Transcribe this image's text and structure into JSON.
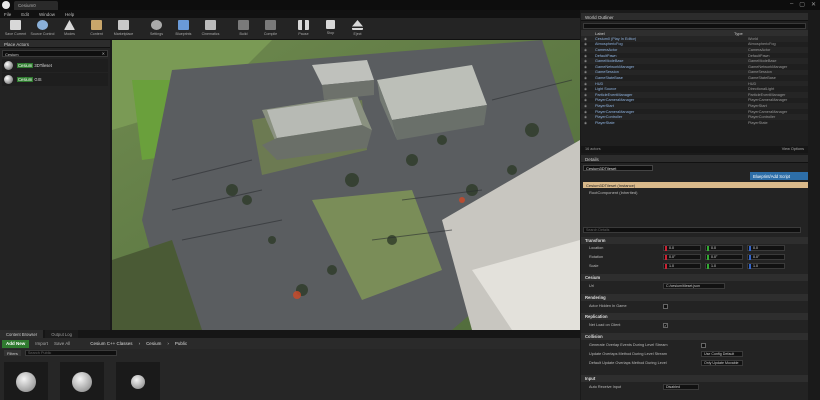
{
  "window": {
    "tab_title": "Cesium0",
    "controls": [
      "–",
      "▢",
      "✕"
    ]
  },
  "menu": [
    "File",
    "Edit",
    "Window",
    "Help"
  ],
  "toolbar": {
    "buttons": [
      {
        "label": "Save Current",
        "icon": "save-icon",
        "color": "#d8d8d8"
      },
      {
        "label": "Source Control",
        "icon": "source-control-icon",
        "color": "#8ab0d8"
      },
      {
        "label": "Modes",
        "icon": "modes-icon",
        "color": "#d8d8d8"
      },
      {
        "label": "Content",
        "icon": "content-icon",
        "color": "#c9a66b"
      },
      {
        "label": "Marketplace",
        "icon": "marketplace-icon",
        "color": "#c8c8c8"
      },
      {
        "label": "Settings",
        "icon": "settings-icon",
        "color": "#aaaaaa"
      },
      {
        "label": "Blueprints",
        "icon": "blueprints-icon",
        "color": "#6a9ad8"
      },
      {
        "label": "Cinematics",
        "icon": "cinematics-icon",
        "color": "#bbbbbb"
      },
      {
        "label": "Build",
        "icon": "build-icon",
        "color": "#7a7a7a"
      },
      {
        "label": "Compile",
        "icon": "compile-icon",
        "color": "#7a7a7a"
      },
      {
        "label": "Pause",
        "icon": "pause-icon",
        "color": "#d8d8d8"
      },
      {
        "label": "Stop",
        "icon": "stop-icon",
        "color": "#d8d8d8"
      },
      {
        "label": "Eject",
        "icon": "eject-icon",
        "color": "#d8d8d8"
      }
    ]
  },
  "place_actors": {
    "tab": "Place Actors",
    "search_value": "Cesium",
    "items": [
      {
        "highlight": "Cesium",
        "rest": " 3DTileset"
      },
      {
        "highlight": "Cesium",
        "rest": " GIS"
      }
    ]
  },
  "outliner": {
    "title": "World Outliner",
    "col_label": "Label",
    "col_type": "Type",
    "rows": [
      {
        "label": "Cesium0 (Play In Editor)",
        "type": "World"
      },
      {
        "label": "AtmosphericFog",
        "type": "AtmosphericFog"
      },
      {
        "label": "CameraActor",
        "type": "CameraActor"
      },
      {
        "label": "DefaultPawn",
        "type": "DefaultPawn"
      },
      {
        "label": "GameModeBase",
        "type": "GameModeBase"
      },
      {
        "label": "GameNetworkManager",
        "type": "GameNetworkManager"
      },
      {
        "label": "GameSession",
        "type": "GameSession"
      },
      {
        "label": "GameStateBase",
        "type": "GameStateBase"
      },
      {
        "label": "HUD",
        "type": "HUD"
      },
      {
        "label": "Light Source",
        "type": "DirectionalLight"
      },
      {
        "label": "ParticleEventManager",
        "type": "ParticleEventManager"
      },
      {
        "label": "PlayerCameraManager",
        "type": "PlayerCameraManager"
      },
      {
        "label": "PlayerStart",
        "type": "PlayerStart"
      },
      {
        "label": "PlayerCameraManager",
        "type": "PlayerCameraManager"
      },
      {
        "label": "PlayerController",
        "type": "PlayerController"
      },
      {
        "label": "PlayerState",
        "type": "PlayerState"
      }
    ],
    "actor_count": "16 actors",
    "view_options": "View Options"
  },
  "details": {
    "tab": "Details",
    "name_value": "Cesium3DTileset",
    "blueprint_button": "Blueprint/Add Script",
    "selected_component": "Cesium3DTileset (Instance)",
    "sub_component": "RootComponent (Inherited)",
    "search_placeholder": "Search Details",
    "transform": {
      "title": "Transform",
      "location": {
        "label": "Location",
        "x": "0.0",
        "y": "0.0",
        "z": "0.0"
      },
      "rotation": {
        "label": "Rotation",
        "x": "0.0°",
        "y": "0.0°",
        "z": "0.0°"
      },
      "scale": {
        "label": "Scale",
        "x": "1.0",
        "y": "1.0",
        "z": "1.0"
      }
    },
    "cesium": {
      "title": "Cesium",
      "url_label": "Url",
      "url_value": "C:/cesium/tileset.json"
    },
    "rendering": {
      "title": "Rendering",
      "prop": "Actor Hidden In Game"
    },
    "replication": {
      "title": "Replication",
      "prop": "Net Load on Client"
    },
    "collision": {
      "title": "Collision",
      "props": [
        {
          "label": "Generate Overlap Events During Level Stream",
          "value": ""
        },
        {
          "label": "Update Overlaps Method During Level Stream",
          "value": "Use Config Default"
        },
        {
          "label": "Default Update Overlaps Method During Level",
          "value": "Only Update Movable"
        }
      ]
    },
    "input": {
      "title": "Input",
      "prop": "Auto Receive Input",
      "value": "Disabled"
    }
  },
  "content_browser": {
    "tab": "Content Browser",
    "tab2": "Output Log",
    "add_new": "Add New",
    "import": "Import",
    "save_all": "Save All",
    "crumbs": [
      "Cesium C++ Classes",
      "Cesium",
      "Public"
    ],
    "filters": "Filters",
    "search_placeholder": "Search Public"
  },
  "colors": {
    "accent_green": "#2f7a2f",
    "accent_blue": "#2d6ea8",
    "selection": "#d9b98a"
  }
}
